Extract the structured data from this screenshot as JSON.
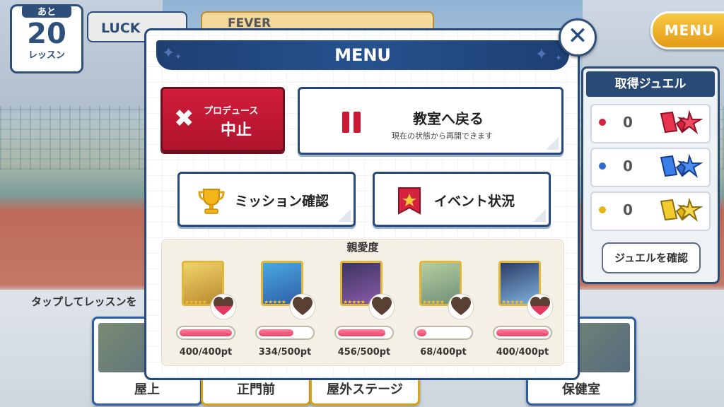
{
  "hud": {
    "lessons_prefix": "あと",
    "lessons_left": "20",
    "lessons_suffix": "レッスン",
    "luck_label": "LUCK",
    "fever_label": "FEVER",
    "menu_button": "MENU"
  },
  "background": {
    "tap_hint": "タップしてレッスンを",
    "locations": [
      "屋上",
      "正門前",
      "屋外ステージ",
      "",
      "保健室"
    ]
  },
  "jewels": {
    "title": "取得ジュエル",
    "rows": [
      {
        "color": "red",
        "count": "0",
        "dot": "#d6213f"
      },
      {
        "color": "blue",
        "count": "0",
        "dot": "#2f6ad0"
      },
      {
        "color": "yellow",
        "count": "0",
        "dot": "#e2b417"
      }
    ],
    "check_button": "ジュエルを確認"
  },
  "modal": {
    "title": "MENU",
    "close_icon": "close-icon",
    "produce": {
      "line1": "プロデュース",
      "line2": "中止"
    },
    "return": {
      "title": "教室へ戻る",
      "subtitle": "現在の状態から再開できます"
    },
    "mission_label": "ミッション確認",
    "event_label": "イベント状況",
    "affection_title": "親愛度",
    "characters": [
      {
        "pt": "400/400pt",
        "ratio": 1.0,
        "heart_fill": 0.5,
        "color1": "#f2d36a",
        "color2": "#b98a2e"
      },
      {
        "pt": "334/500pt",
        "ratio": 0.668,
        "heart_fill": 0.0,
        "color1": "#49a9df",
        "color2": "#2f5ea8"
      },
      {
        "pt": "456/500pt",
        "ratio": 0.912,
        "heart_fill": 0.0,
        "color1": "#3b3560",
        "color2": "#8a5aa8"
      },
      {
        "pt": "68/400pt",
        "ratio": 0.17,
        "heart_fill": 0.0,
        "color1": "#b6cfa0",
        "color2": "#6f8f78"
      },
      {
        "pt": "400/400pt",
        "ratio": 1.0,
        "heart_fill": 0.5,
        "color1": "#2b3c66",
        "color2": "#7fb3df"
      }
    ]
  }
}
